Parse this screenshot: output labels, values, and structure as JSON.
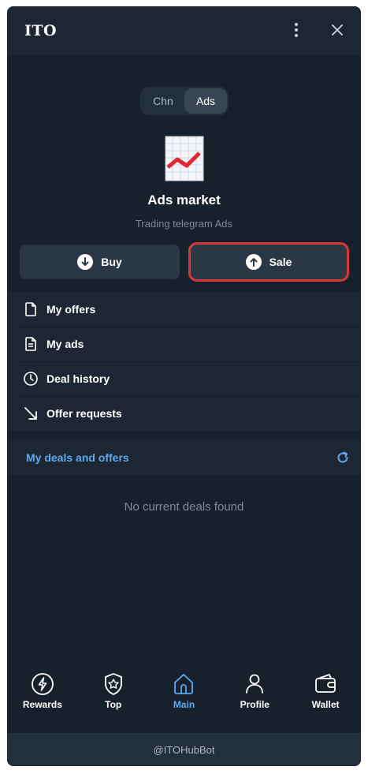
{
  "app": {
    "title": "ITO"
  },
  "segment": {
    "items": [
      "Chn",
      "Ads"
    ],
    "active": "Ads"
  },
  "hero": {
    "icon": "chart-increasing-icon",
    "title": "Ads market",
    "subtitle": "Trading telegram Ads"
  },
  "actions": {
    "buy_label": "Buy",
    "sale_label": "Sale"
  },
  "menu": {
    "items": [
      {
        "label": "My offers",
        "icon": "file-icon"
      },
      {
        "label": "My ads",
        "icon": "document-icon"
      },
      {
        "label": "Deal history",
        "icon": "clock-icon"
      },
      {
        "label": "Offer requests",
        "icon": "arrow-down-right-icon"
      }
    ]
  },
  "deals": {
    "title": "My deals and offers",
    "empty": "No current deals found"
  },
  "tabs": [
    {
      "label": "Rewards",
      "icon": "lightning-icon"
    },
    {
      "label": "Top",
      "icon": "star-badge-icon"
    },
    {
      "label": "Main",
      "icon": "home-icon",
      "active": true
    },
    {
      "label": "Profile",
      "icon": "user-icon"
    },
    {
      "label": "Wallet",
      "icon": "wallet-icon"
    }
  ],
  "footer": {
    "text": "@ITOHubBot"
  },
  "colors": {
    "accent": "#5eaaf0",
    "highlight": "#d9383a",
    "background": "#17212b"
  }
}
